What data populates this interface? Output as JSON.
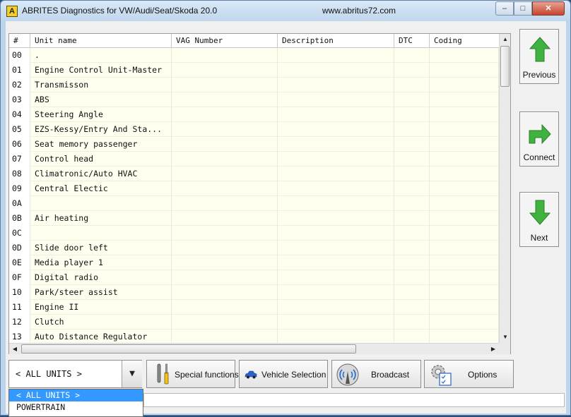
{
  "window": {
    "app_icon_letter": "A",
    "title": "ABRITES Diagnostics for VW/Audi/Seat/Skoda 20.0",
    "url": "www.abritus72.com"
  },
  "grid": {
    "columns": [
      "#",
      "Unit name",
      "VAG Number",
      "Description",
      "DTC",
      "Coding"
    ],
    "rows": [
      {
        "num": "00",
        "name": "."
      },
      {
        "num": "01",
        "name": "Engine Control Unit-Master"
      },
      {
        "num": "02",
        "name": "Transmisson"
      },
      {
        "num": "03",
        "name": "ABS"
      },
      {
        "num": "04",
        "name": "Steering Angle"
      },
      {
        "num": "05",
        "name": "EZS-Kessy/Entry And Sta..."
      },
      {
        "num": "06",
        "name": "Seat memory passenger"
      },
      {
        "num": "07",
        "name": "Control head"
      },
      {
        "num": "08",
        "name": "Climatronic/Auto HVAC"
      },
      {
        "num": "09",
        "name": "Central Electic"
      },
      {
        "num": "0A",
        "name": ""
      },
      {
        "num": "0B",
        "name": "Air heating"
      },
      {
        "num": "0C",
        "name": ""
      },
      {
        "num": "0D",
        "name": "Slide door left"
      },
      {
        "num": "0E",
        "name": "Media player 1"
      },
      {
        "num": "0F",
        "name": "Digital radio"
      },
      {
        "num": "10",
        "name": "Park/steer assist"
      },
      {
        "num": "11",
        "name": "Engine II"
      },
      {
        "num": "12",
        "name": "Clutch"
      },
      {
        "num": "13",
        "name": "Auto Distance Regulator"
      }
    ]
  },
  "nav": {
    "previous_label": "Previous",
    "connect_label": "Connect",
    "next_label": "Next"
  },
  "units_select": {
    "value": "< ALL UNITS >",
    "options": [
      "< ALL UNITS >",
      "POWERTRAIN"
    ]
  },
  "toolbar": {
    "special_label": "Special functions",
    "vehicle_label": "Vehicle Selection",
    "broadcast_label": "Broadcast",
    "options_label": "Options"
  },
  "colors": {
    "row_background": "#fffff0",
    "arrow_green": "#3fb33f",
    "selection_blue": "#3399ff"
  }
}
